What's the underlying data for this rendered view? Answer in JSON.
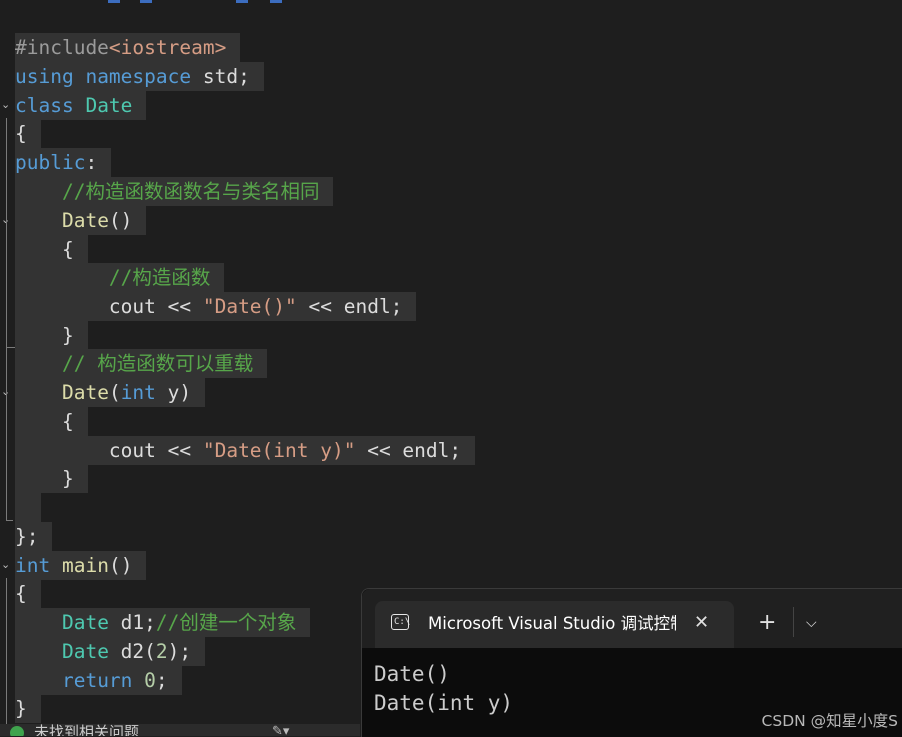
{
  "editor": {
    "line01": [
      {
        "t": "#include",
        "c": "pp"
      },
      {
        "t": "<iostream>",
        "c": "hd"
      }
    ],
    "line02": [
      {
        "t": "using",
        "c": "kw"
      },
      {
        "t": " ",
        "c": "pl"
      },
      {
        "t": "namespace",
        "c": "kw"
      },
      {
        "t": " std;",
        "c": "pl"
      }
    ],
    "line03": [
      {
        "t": "class",
        "c": "kw"
      },
      {
        "t": " ",
        "c": "pl"
      },
      {
        "t": "Date",
        "c": "ty"
      }
    ],
    "line04": [
      {
        "t": "{",
        "c": "pl"
      }
    ],
    "line05": [
      {
        "t": "public",
        "c": "kw"
      },
      {
        "t": ":",
        "c": "pl"
      }
    ],
    "line06": [
      {
        "t": "    ",
        "c": "pl"
      },
      {
        "t": "//构造函数函数名与类名相同",
        "c": "cm"
      }
    ],
    "line07": [
      {
        "t": "    ",
        "c": "pl"
      },
      {
        "t": "Date",
        "c": "fn"
      },
      {
        "t": "()",
        "c": "pl"
      }
    ],
    "line08": [
      {
        "t": "    {",
        "c": "pl"
      }
    ],
    "line09": [
      {
        "t": "        ",
        "c": "pl"
      },
      {
        "t": "//构造函数",
        "c": "cm"
      }
    ],
    "line10": [
      {
        "t": "        cout << ",
        "c": "pl"
      },
      {
        "t": "\"Date()\"",
        "c": "st"
      },
      {
        "t": " << endl;",
        "c": "pl"
      }
    ],
    "line11": [
      {
        "t": "    }",
        "c": "pl"
      }
    ],
    "line12": [
      {
        "t": "    ",
        "c": "pl"
      },
      {
        "t": "// 构造函数可以重载",
        "c": "cm"
      }
    ],
    "line13": [
      {
        "t": "    ",
        "c": "pl"
      },
      {
        "t": "Date",
        "c": "fn"
      },
      {
        "t": "(",
        "c": "pl"
      },
      {
        "t": "int",
        "c": "kw"
      },
      {
        "t": " y)",
        "c": "pl"
      }
    ],
    "line14": [
      {
        "t": "    {",
        "c": "pl"
      }
    ],
    "line15": [
      {
        "t": "        cout << ",
        "c": "pl"
      },
      {
        "t": "\"Date(int y)\"",
        "c": "st"
      },
      {
        "t": " << endl;",
        "c": "pl"
      }
    ],
    "line16": [
      {
        "t": "    }",
        "c": "pl"
      }
    ],
    "line17": [
      {
        "t": "",
        "c": "pl"
      }
    ],
    "line18": [
      {
        "t": "};",
        "c": "pl"
      }
    ],
    "line19": [
      {
        "t": "int",
        "c": "kw"
      },
      {
        "t": " ",
        "c": "pl"
      },
      {
        "t": "main",
        "c": "fn"
      },
      {
        "t": "()",
        "c": "pl"
      }
    ],
    "line20": [
      {
        "t": "{",
        "c": "pl"
      }
    ],
    "line21": [
      {
        "t": "    ",
        "c": "pl"
      },
      {
        "t": "Date",
        "c": "ty"
      },
      {
        "t": " d1;",
        "c": "pl"
      },
      {
        "t": "//创建一个对象",
        "c": "cm"
      }
    ],
    "line22": [
      {
        "t": "    ",
        "c": "pl"
      },
      {
        "t": "Date",
        "c": "ty"
      },
      {
        "t": " d2(",
        "c": "pl"
      },
      {
        "t": "2",
        "c": "nm"
      },
      {
        "t": ");",
        "c": "pl"
      }
    ],
    "line23": [
      {
        "t": "    ",
        "c": "pl"
      },
      {
        "t": "return",
        "c": "kw"
      },
      {
        "t": " ",
        "c": "pl"
      },
      {
        "t": "0",
        "c": "nm"
      },
      {
        "t": ";",
        "c": "pl"
      }
    ],
    "line24": [
      {
        "t": "}",
        "c": "pl"
      }
    ]
  },
  "status": {
    "text": "未找到相关问题"
  },
  "terminal": {
    "tab_title": "Microsoft Visual Studio 调试控制台",
    "tab_icon_glyph": "C:\\",
    "close_glyph": "✕",
    "new_tab_glyph": "+",
    "dropdown_glyph": "⌵",
    "output": [
      "Date()",
      "Date(int y)"
    ]
  },
  "watermark": "CSDN @知星小度S",
  "colors": {
    "keyword": "#569cd6",
    "type": "#4ec9b0",
    "function": "#dcdcaa",
    "comment": "#57a64a",
    "string": "#d69d85",
    "number": "#b5cea8",
    "background": "#1e1e1e"
  }
}
